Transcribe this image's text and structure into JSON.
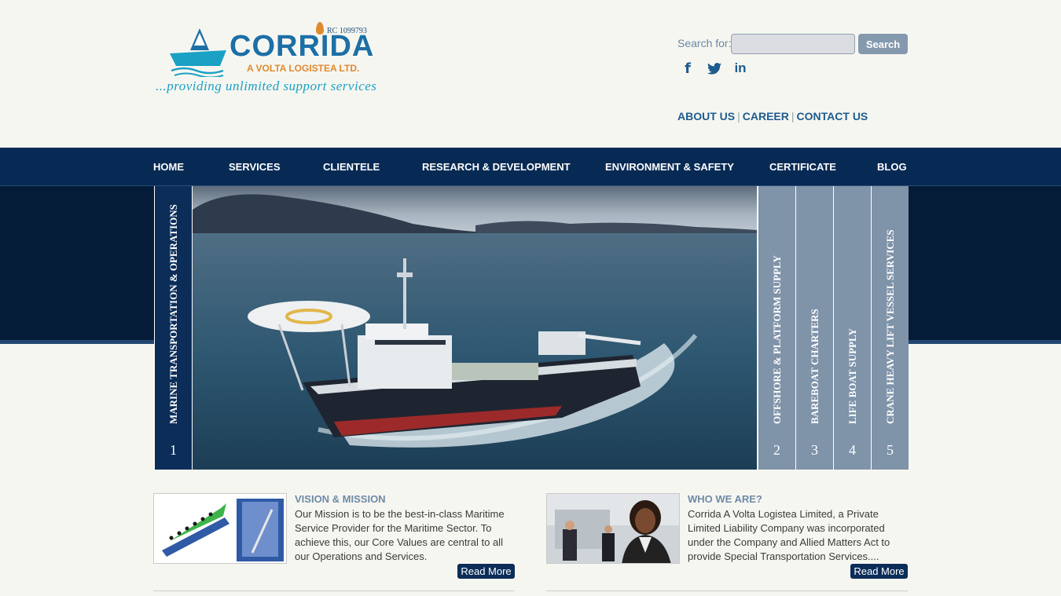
{
  "logo": {
    "brand": "CORRIDA",
    "rc": "RC 1099793",
    "subtitle": "A VOLTA LOGISTEA LTD.",
    "tagline": "...providing unlimited support services"
  },
  "search": {
    "label": "Search for:",
    "placeholder": "",
    "button": "Search"
  },
  "social": [
    "facebook-icon",
    "twitter-icon",
    "linkedin-icon"
  ],
  "top_links": [
    {
      "label": "ABOUT US"
    },
    {
      "label": "CAREER"
    },
    {
      "label": "CONTACT US"
    }
  ],
  "nav": [
    {
      "label": "HOME"
    },
    {
      "label": "SERVICES"
    },
    {
      "label": "CLIENTELE"
    },
    {
      "label": "RESEARCH & DEVELOPMENT"
    },
    {
      "label": "ENVIRONMENT & SAFETY"
    },
    {
      "label": "CERTIFICATE"
    },
    {
      "label": "BLOG"
    }
  ],
  "slider": {
    "tabs": [
      {
        "label": "MARINE TRANSPORTATION & OPERATIONS",
        "num": "1"
      },
      {
        "label": "OFFSHORE & PLATFORM SUPPLY",
        "num": "2"
      },
      {
        "label": "BAREBOAT CHARTERS",
        "num": "3"
      },
      {
        "label": "LIFE BOAT SUPPLY",
        "num": "4"
      },
      {
        "label": "CRANE HEAVY LIFT VESSEL SERVICES",
        "num": "5"
      }
    ]
  },
  "panels": [
    {
      "title": "VISION & MISSION",
      "text": "Our Mission is to be the best-in-class Maritime Service Provider for the Maritime Sector. To achieve this, our Core Values are central to all our Operations and Services.",
      "button": "Read More"
    },
    {
      "title": "WHO WE ARE?",
      "text": "Corrida A Volta Logistea Limited, a Private Limited Liability Company was incorporated under the Company and Allied Matters Act to provide Special Transportation Services....",
      "button": "Read More"
    }
  ],
  "colors": {
    "nav_bg": "#072a54",
    "accent": "#1d5c8e",
    "tab_active": "#0b2d58",
    "tab_inactive": "#7f93a9"
  }
}
